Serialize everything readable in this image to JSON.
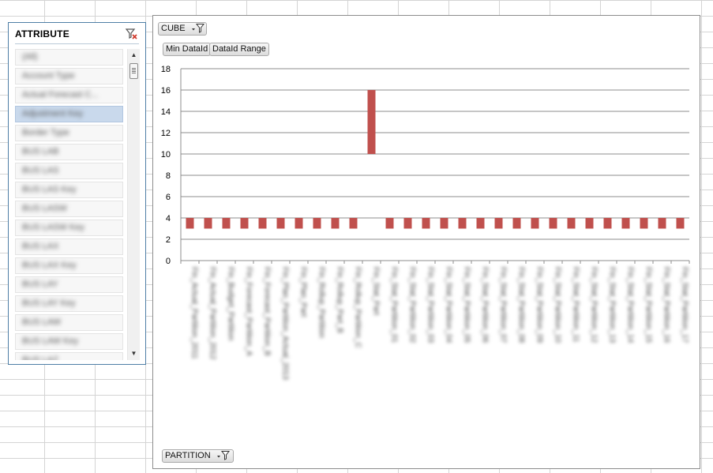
{
  "slicer": {
    "title": "ATTRIBUTE",
    "items": [
      "(All)",
      "Account Type",
      "Actual Forecast C...",
      "Adjustment Key",
      "Border Type",
      "BUS LAB",
      "BUS LAS",
      "BUS LAS Key",
      "BUS LASW",
      "BUS LASW Key",
      "BUS LAX",
      "BUS LAX Key",
      "BUS LAY",
      "BUS LAY Key",
      "BUS LAW",
      "BUS LAW Key",
      "BUS LAZ"
    ],
    "selected_index": 3
  },
  "chart": {
    "filter_field": "CUBE",
    "value_fields": [
      "Min DataId",
      "DataId Range"
    ],
    "axis_field": "PARTITION",
    "x_labels_blurred": [
      "Fin_Actual_Partition_2011",
      "Fin_Actual_Partition_2012",
      "Fin_Budget_Partition",
      "Fin_Forecast_Partition_A",
      "Fin_Forecast_Partition_B",
      "Fin_Plan_Partition_Actual_2013",
      "Fin_Plan_Part",
      "Fin_Rollup_Partition",
      "Fin_Rollup_Part_B",
      "Fin_Rollup_Partition_C",
      "Fin_Stat_Part",
      "Fin_Stat_Partition_01",
      "Fin_Stat_Partition_02",
      "Fin_Stat_Partition_03",
      "Fin_Stat_Partition_04",
      "Fin_Stat_Partition_05",
      "Fin_Stat_Partition_06",
      "Fin_Stat_Partition_07",
      "Fin_Stat_Partition_08",
      "Fin_Stat_Partition_09",
      "Fin_Stat_Partition_10",
      "Fin_Stat_Partition_11",
      "Fin_Stat_Partition_12",
      "Fin_Stat_Partition_13",
      "Fin_Stat_Partition_14",
      "Fin_Stat_Partition_15",
      "Fin_Stat_Partition_16",
      "Fin_Stat_Partition_17"
    ]
  },
  "chart_data": {
    "type": "bar",
    "stacked": true,
    "ylim": [
      0,
      18
    ],
    "yticks": [
      0,
      2,
      4,
      6,
      8,
      10,
      12,
      14,
      16,
      18
    ],
    "grid": true,
    "series": [
      {
        "name": "Min DataId",
        "color": "#ffffff",
        "values": [
          3,
          3,
          3,
          3,
          3,
          3,
          3,
          3,
          3,
          3,
          10,
          3,
          3,
          3,
          3,
          3,
          3,
          3,
          3,
          3,
          3,
          3,
          3,
          3,
          3,
          3,
          3,
          3
        ]
      },
      {
        "name": "DataId Range",
        "color": "#c0504d",
        "values": [
          1,
          1,
          1,
          1,
          1,
          1,
          1,
          1,
          1,
          1,
          6,
          1,
          1,
          1,
          1,
          1,
          1,
          1,
          1,
          1,
          1,
          1,
          1,
          1,
          1,
          1,
          1,
          1
        ]
      }
    ]
  }
}
